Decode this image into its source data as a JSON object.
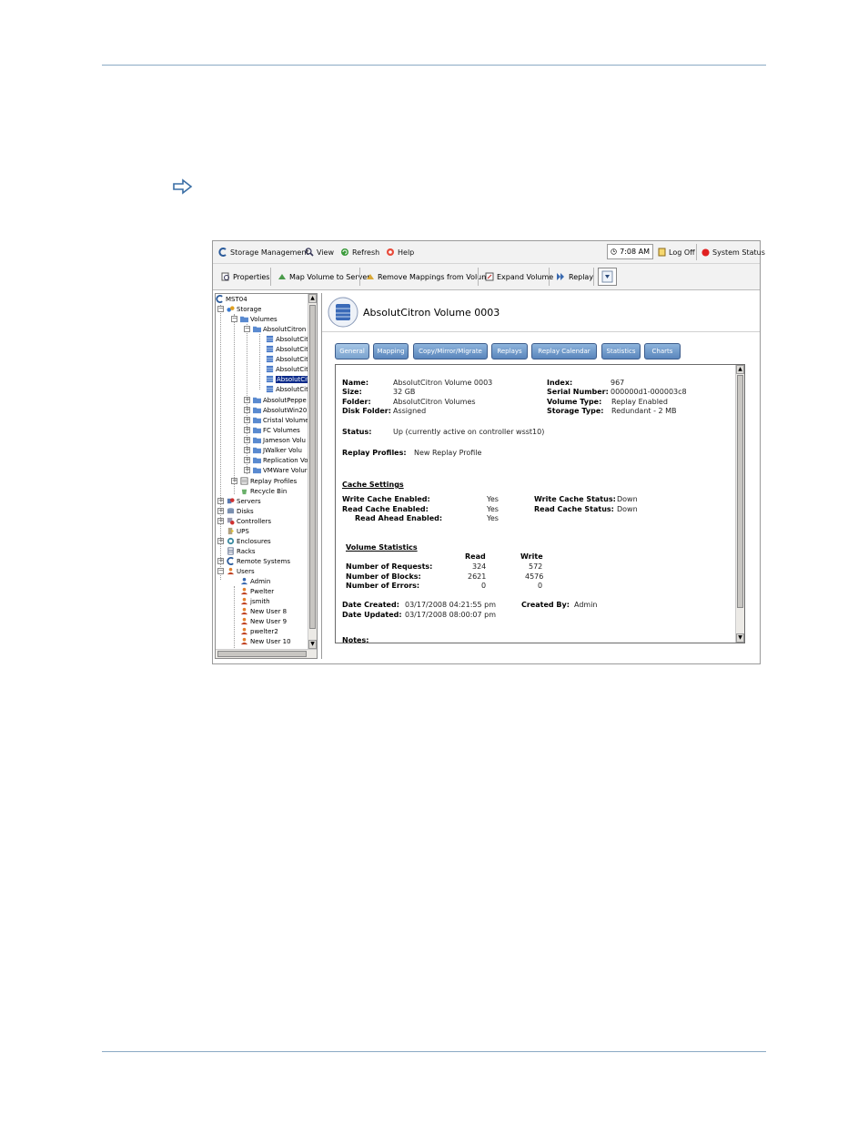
{
  "menubar": {
    "storage_management": "Storage Management",
    "view": "View",
    "refresh": "Refresh",
    "help": "Help",
    "time": "7:08 AM",
    "log_off": "Log Off",
    "system_status": "System Status"
  },
  "toolbar": {
    "properties": "Properties",
    "map_volume": "Map Volume to Server",
    "remove_mappings": "Remove Mappings from Volume",
    "expand_volume": "Expand Volume",
    "replay": "Replay"
  },
  "tree": {
    "root": "MST04",
    "storage": "Storage",
    "volumes": "Volumes",
    "absolut_citron": "AbsolutCitron",
    "citron_volumes": [
      "AbsolutCit",
      "AbsolutCit",
      "AbsolutCit",
      "AbsolutCit",
      "AbsolutCit",
      "AbsolutCit"
    ],
    "folders": [
      "AbsolutPeppe",
      "AbsolutWin20",
      "Cristal Volume",
      "FC Volumes",
      "Jameson Volu",
      "JWalker Volu",
      "Replication Vo",
      "VMWare Volur"
    ],
    "replay_profiles": "Replay Profiles",
    "recycle_bin": "Recycle Bin",
    "servers": "Servers",
    "disks": "Disks",
    "controllers": "Controllers",
    "ups": "UPS",
    "enclosures": "Enclosures",
    "racks": "Racks",
    "remote_systems": "Remote Systems",
    "users": "Users",
    "user_list": [
      "Admin",
      "Pwelter",
      "jsmith",
      "New User 8",
      "New User 9",
      "pwelter2",
      "New User 10"
    ]
  },
  "detail": {
    "title": "AbsolutCitron Volume 0003",
    "tabs": [
      "General",
      "Mapping",
      "Copy/Mirror/Migrate",
      "Replays",
      "Replay Calendar",
      "Statistics",
      "Charts"
    ],
    "general": {
      "name_label": "Name:",
      "name_value": "AbsolutCitron Volume 0003",
      "size_label": "Size:",
      "size_value": "32 GB",
      "folder_label": "Folder:",
      "folder_value": "AbsolutCitron Volumes",
      "disk_folder_label": "Disk Folder:",
      "disk_folder_value": "Assigned",
      "index_label": "Index:",
      "index_value": "967",
      "serial_label": "Serial Number:",
      "serial_value": "000000d1-000003c8",
      "volume_type_label": "Volume Type:",
      "volume_type_value": "Replay Enabled",
      "storage_type_label": "Storage Type:",
      "storage_type_value": "Redundant - 2 MB",
      "status_label": "Status:",
      "status_value": "Up (currently active on controller wsst10)",
      "replay_profiles_label": "Replay Profiles:",
      "replay_profiles_value": "New  Replay Profile",
      "cache_heading": "Cache Settings",
      "write_cache_enabled_label": "Write Cache Enabled:",
      "write_cache_enabled_value": "Yes",
      "read_cache_enabled_label": "Read Cache Enabled:",
      "read_cache_enabled_value": "Yes",
      "read_ahead_label": "Read Ahead Enabled:",
      "read_ahead_value": "Yes",
      "write_cache_status_label": "Write Cache Status:",
      "write_cache_status_value": "Down",
      "read_cache_status_label": "Read Cache Status:",
      "read_cache_status_value": "Down",
      "stats_heading": "Volume Statistics",
      "read_header": "Read",
      "write_header": "Write",
      "requests_label": "Number of Requests:",
      "requests_read": "324",
      "requests_write": "572",
      "blocks_label": "Number of Blocks:",
      "blocks_read": "2621",
      "blocks_write": "4576",
      "errors_label": "Number of Errors:",
      "errors_read": "0",
      "errors_write": "0",
      "created_label": "Date Created:",
      "created_value": "03/17/2008 04:21:55 pm",
      "created_by_label": "Created By:",
      "created_by_value": "Admin",
      "updated_label": "Date Updated:",
      "updated_value": "03/17/2008 08:00:07 pm",
      "notes_label": "Notes:"
    }
  },
  "colors": {
    "accent": "#5a86bc",
    "selection": "#0a2a8a",
    "rule": "#8aaac4"
  }
}
